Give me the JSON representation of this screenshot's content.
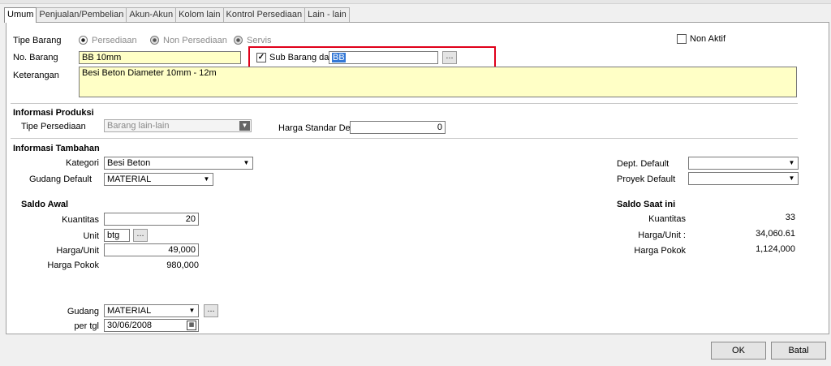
{
  "tabs": [
    "Umum",
    "Penjualan/Pembelian",
    "Akun-Akun",
    "Kolom lain",
    "Kontrol Persediaan",
    "Lain - lain"
  ],
  "tipe_barang": {
    "label": "Tipe Barang",
    "options": [
      "Persediaan",
      "Non Persediaan",
      "Servis"
    ],
    "selected": "Persediaan"
  },
  "non_aktif_label": "Non Aktif",
  "no_barang": {
    "label": "No. Barang",
    "value": "BB 10mm"
  },
  "sub_barang": {
    "label": "Sub Barang dari",
    "checked": true,
    "value": "BB",
    "browse": "..."
  },
  "keterangan": {
    "label": "Keterangan",
    "value": "Besi Beton Diameter 10mm - 12m"
  },
  "informasi_produksi": {
    "title": "Informasi Produksi",
    "tipe_persediaan_label": "Tipe Persediaan",
    "tipe_persediaan_value": "Barang lain-lain",
    "harga_standar_label": "Harga Standar Def.",
    "harga_standar_value": "0"
  },
  "informasi_tambahan": {
    "title": "Informasi Tambahan",
    "kategori_label": "Kategori",
    "kategori_value": "Besi Beton",
    "gudang_default_label": "Gudang Default",
    "gudang_default_value": "MATERIAL",
    "dept_label": "Dept. Default",
    "dept_value": "",
    "proyek_label": "Proyek Default",
    "proyek_value": ""
  },
  "saldo_awal": {
    "title": "Saldo Awal",
    "kuantitas_label": "Kuantitas",
    "kuantitas_value": "20",
    "unit_label": "Unit",
    "unit_value": "btg",
    "harga_unit_label": "Harga/Unit",
    "harga_unit_value": "49,000",
    "harga_pokok_label": "Harga Pokok",
    "harga_pokok_value": "980,000"
  },
  "saldo_saat_ini": {
    "title": "Saldo Saat ini",
    "kuantitas_label": "Kuantitas",
    "kuantitas_value": "33",
    "harga_unit_label": "Harga/Unit :",
    "harga_unit_value": "34,060.61",
    "harga_pokok_label": "Harga Pokok",
    "harga_pokok_value": "1,124,000"
  },
  "gudang": {
    "label": "Gudang",
    "value": "MATERIAL",
    "per_tgl_label": "per tgl",
    "per_tgl_value": "30/06/2008"
  },
  "buttons": {
    "ok": "OK",
    "batal": "Batal",
    "browse": "..."
  }
}
